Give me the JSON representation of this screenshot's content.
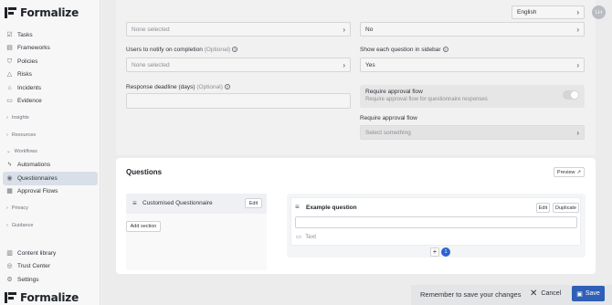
{
  "app": {
    "name": "Formalize"
  },
  "sidebar": {
    "items": [
      {
        "label": "Tasks",
        "icon": "tasks-icon"
      },
      {
        "label": "Frameworks",
        "icon": "frameworks-icon"
      },
      {
        "label": "Policies",
        "icon": "shield-icon"
      },
      {
        "label": "Risks",
        "icon": "warning-icon"
      },
      {
        "label": "Incidents",
        "icon": "incident-icon"
      },
      {
        "label": "Evidence",
        "icon": "document-icon"
      }
    ],
    "groups": {
      "insights": "Insights",
      "resources": "Resources",
      "workflows": "Workflows",
      "privacy": "Privacy",
      "guidance": "Guidance"
    },
    "workflow_items": [
      {
        "label": "Automations",
        "icon": "lightning-icon"
      },
      {
        "label": "Questionnaires",
        "icon": "questionnaire-icon",
        "active": true
      },
      {
        "label": "Approval Flows",
        "icon": "approval-icon"
      }
    ],
    "bottom_items": [
      {
        "label": "Content library",
        "icon": "library-icon"
      },
      {
        "label": "Trust Center",
        "icon": "trust-icon"
      },
      {
        "label": "Settings",
        "icon": "gear-icon"
      }
    ]
  },
  "header": {
    "language": "English",
    "avatar_initials": "LH"
  },
  "form": {
    "top_left_select": "None selected",
    "top_right_select": "No",
    "notify_label": "Users to notify on completion",
    "notify_optional": "(Optional)",
    "notify_value": "None selected",
    "sidebar_label": "Show each question in sidebar",
    "sidebar_value": "Yes",
    "deadline_label": "Response deadline (days)",
    "deadline_optional": "(Optional)",
    "approval_title": "Require approval flow",
    "approval_desc": "Require approval flow for questionnaire responses",
    "approval_label": "Require approval flow",
    "approval_placeholder": "Select something"
  },
  "modal": {
    "title": "Questions",
    "preview_label": "Preview",
    "questionnaire_name": "Customised Questionnaire",
    "edit_label": "Edit",
    "add_section_label": "Add section",
    "question_title": "Example question",
    "question_edit_label": "Edit",
    "duplicate_label": "Duplicate",
    "answer_type": "Text",
    "question_count": "1"
  },
  "footer": {
    "save_message": "Remember to save your changes",
    "cancel_label": "Cancel",
    "save_label": "Save"
  },
  "colors": {
    "accent": "#2f5fb6",
    "badge": "#2a63d3",
    "active_nav": "#d9dfe8"
  }
}
